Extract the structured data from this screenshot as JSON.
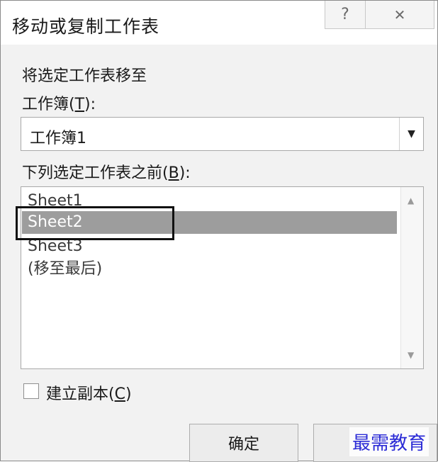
{
  "dialog": {
    "title": "移动或复制工作表",
    "help_glyph": "?",
    "close_glyph": "✕",
    "move_label": "将选定工作表移至",
    "book_label_pre": "工作簿(",
    "book_label_key": "T",
    "book_label_post": "):",
    "book_value": "工作簿1",
    "before_label_pre": "下列选定工作表之前(",
    "before_label_key": "B",
    "before_label_post": "):",
    "sheets": [
      "Sheet1",
      "Sheet2",
      "Sheet3",
      "(移至最后)"
    ],
    "selected_sheet": "Sheet2",
    "copy_label_pre": "建立副本(",
    "copy_label_key": "C",
    "copy_label_post": ")",
    "copy_checked": false,
    "ok_label": "确定",
    "cancel_label": ""
  },
  "watermark": "最需教育",
  "colors": {
    "selection": "#9d9d9d",
    "highlight_border": "#111111",
    "watermark": "#2b2bd6"
  },
  "icons": {
    "dropdown": "chevron-down-icon",
    "scroll_up": "scroll-up-icon",
    "scroll_down": "scroll-down-icon"
  }
}
